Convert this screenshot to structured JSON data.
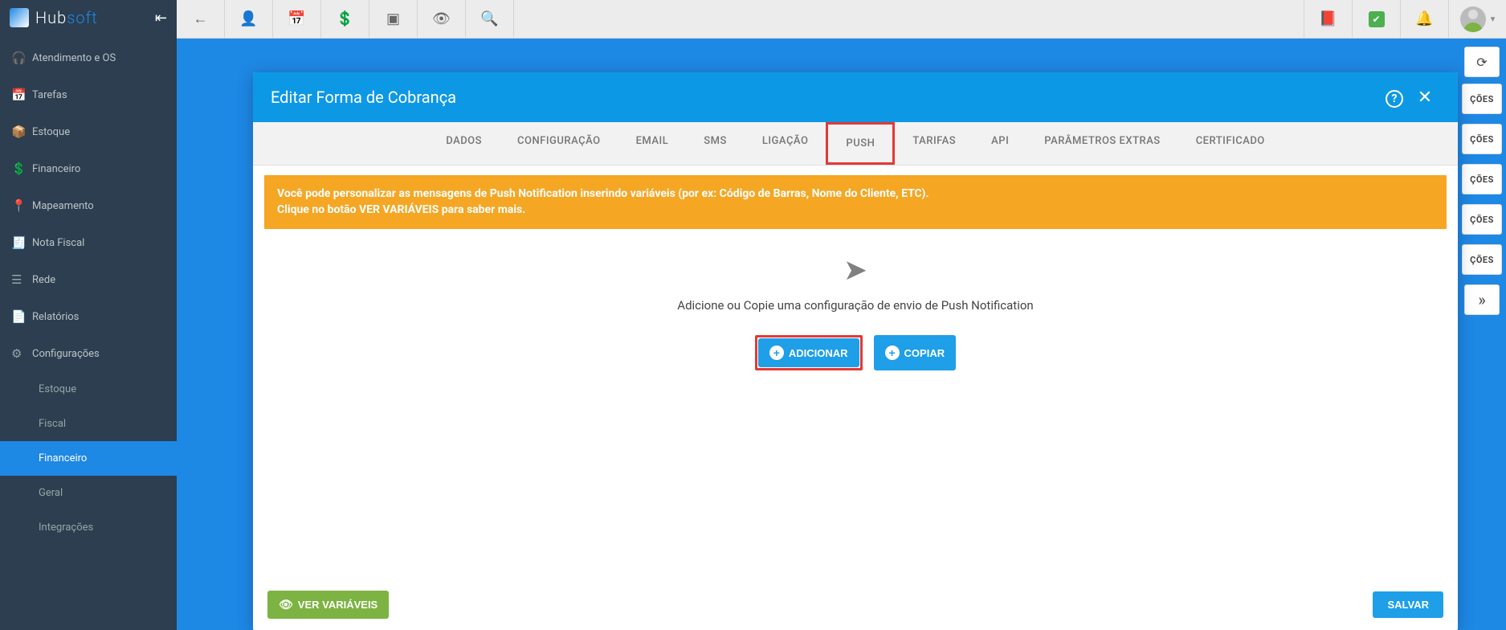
{
  "brand": {
    "hub": "Hub",
    "soft": "soft"
  },
  "sidebar": {
    "items": [
      {
        "icon": "🎧",
        "label": "Atendimento e OS"
      },
      {
        "icon": "📅",
        "label": "Tarefas"
      },
      {
        "icon": "📦",
        "label": "Estoque"
      },
      {
        "icon": "💲",
        "label": "Financeiro"
      },
      {
        "icon": "📍",
        "label": "Mapeamento"
      },
      {
        "icon": "🧾",
        "label": "Nota Fiscal"
      },
      {
        "icon": "☰",
        "label": "Rede"
      },
      {
        "icon": "📄",
        "label": "Relatórios"
      },
      {
        "icon": "⚙",
        "label": "Configurações"
      }
    ],
    "subs": [
      {
        "label": "Estoque"
      },
      {
        "label": "Fiscal"
      },
      {
        "label": "Financeiro"
      },
      {
        "label": "Geral"
      },
      {
        "label": "Integrações"
      }
    ]
  },
  "topbar": {
    "icons": [
      "←",
      "👤",
      "📅",
      "💲",
      "▣",
      "👁",
      "🔍"
    ],
    "right": {
      "pdf": "📕",
      "bell": "🔔",
      "chevron": "▾"
    }
  },
  "right_panel": {
    "refresh": "⟳",
    "coes": "ÇÕES",
    "more": "»"
  },
  "modal": {
    "title": "Editar Forma de Cobrança",
    "help": "?",
    "close": "✕",
    "tabs": [
      "DADOS",
      "CONFIGURAÇÃO",
      "EMAIL",
      "SMS",
      "LIGAÇÃO",
      "PUSH",
      "TARIFAS",
      "API",
      "PARÂMETROS EXTRAS",
      "CERTIFICADO"
    ],
    "banner_line1": "Você pode personalizar as mensagens de Push Notification inserindo variáveis (por ex: Código de Barras, Nome do Cliente, ETC).",
    "banner_line2": "Clique no botão VER VARIÁVEIS para saber mais.",
    "empty_text": "Adicione ou Copie uma configuração de envio de Push Notification",
    "add_label": "ADICIONAR",
    "copy_label": "COPIAR",
    "vars_label": "VER VARIÁVEIS",
    "save_label": "SALVAR"
  }
}
